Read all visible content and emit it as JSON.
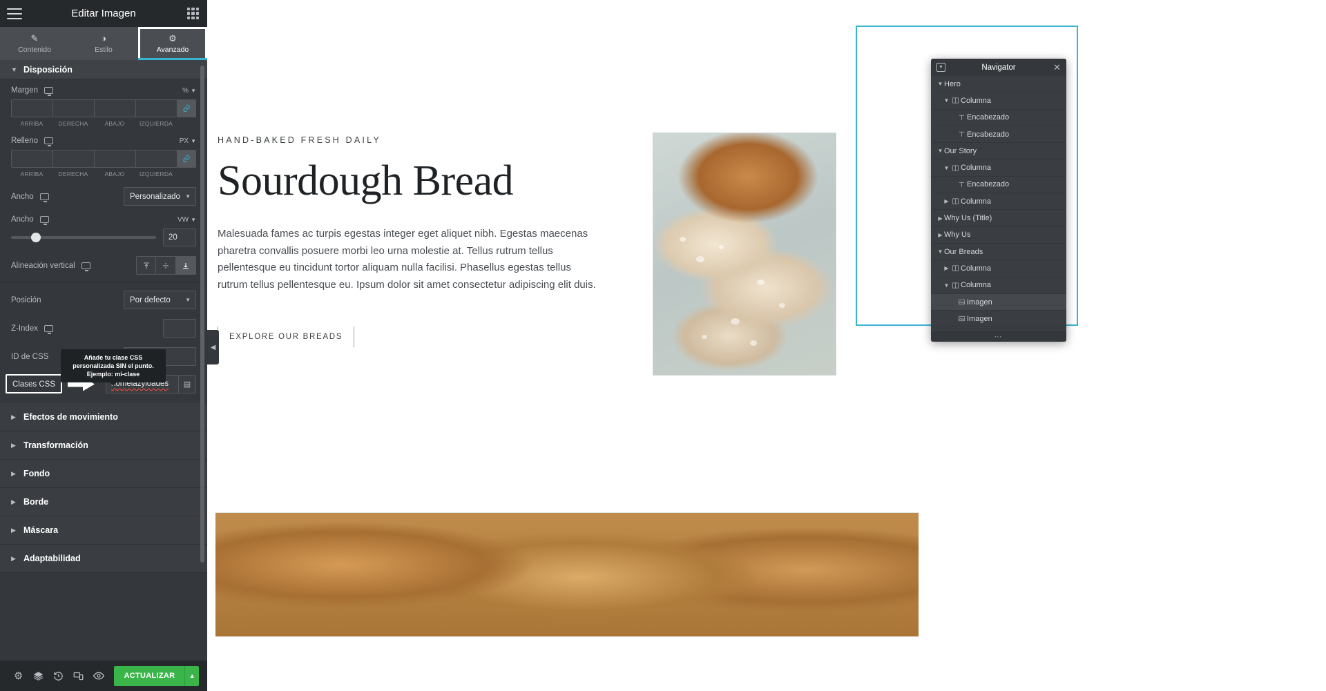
{
  "panel": {
    "title": "Editar Imagen",
    "menu_icon": "hamburger-icon",
    "apps_icon": "apps-grid-icon",
    "tabs": [
      {
        "label": "Contenido",
        "icon": "pencil-icon",
        "active": false
      },
      {
        "label": "Estilo",
        "icon": "contrast-icon",
        "active": false
      },
      {
        "label": "Avanzado",
        "icon": "gear-icon",
        "active": true
      }
    ],
    "sections": {
      "layout": {
        "title": "Disposición",
        "margin": {
          "label": "Margen",
          "unit": "%",
          "values": [
            "",
            "",
            "",
            ""
          ],
          "sides": [
            "ARRIBA",
            "DERECHA",
            "ABAJO",
            "IZQUIERDA"
          ],
          "link_label": "link-icon"
        },
        "padding": {
          "label": "Relleno",
          "unit": "PX",
          "values": [
            "",
            "",
            "",
            ""
          ],
          "sides": [
            "ARRIBA",
            "DERECHA",
            "ABAJO",
            "IZQUIERDA"
          ],
          "link_label": "link-icon"
        },
        "width_mode": {
          "label": "Ancho",
          "value": "Personalizado"
        },
        "width_value": {
          "label": "Ancho",
          "unit": "VW",
          "value": "20",
          "slider_pct": 17
        },
        "vertical_align": {
          "label": "Alineación vertical",
          "options": [
            "top",
            "middle",
            "bottom"
          ],
          "selected": 2
        },
        "position": {
          "label": "Posición",
          "value": "Por defecto"
        },
        "z_index": {
          "label": "Z-Index",
          "value": ""
        },
        "css_id": {
          "label": "ID de CSS",
          "value": ""
        },
        "css_classes": {
          "label": "Clases CSS",
          "value": "nomelazyloades",
          "tooltip": "Añade tu clase CSS personalizada SIN el punto. Ejemplo: mi-clase"
        }
      }
    },
    "collapsed_sections": [
      "Efectos de movimiento",
      "Transformación",
      "Fondo",
      "Borde",
      "Máscara",
      "Adaptabilidad"
    ],
    "footer": {
      "icons": [
        "gear-icon",
        "layers-icon",
        "history-icon",
        "responsive-icon",
        "eye-icon"
      ],
      "update_label": "ACTUALIZAR",
      "update_caret": "caret-up-icon"
    }
  },
  "canvas": {
    "eyebrow": "HAND-BAKED FRESH DAILY",
    "title": "Sourdough Bread",
    "body": "Malesuada fames ac turpis egestas integer eget aliquet nibh. Egestas maecenas pharetra convallis posuere morbi leo urna molestie at. Tellus rutrum tellus pellentesque eu tincidunt tortor aliquam nulla facilisi. Phasellus egestas tellus rutrum tellus pellentesque eu. Ipsum dolor sit amet consectetur adipiscing elit duis.",
    "cta": "EXPLORE OUR BREADS"
  },
  "navigator": {
    "title": "Navigator",
    "dock_icon": "dock-icon",
    "close_icon": "close-icon",
    "more_icon": "ellipsis-icon",
    "items": [
      {
        "label": "Hero",
        "indent": 0,
        "caret": "down",
        "icon": ""
      },
      {
        "label": "Columna",
        "indent": 1,
        "caret": "down",
        "icon": "column-icon"
      },
      {
        "label": "Encabezado",
        "indent": 2,
        "caret": "none",
        "icon": "heading-icon"
      },
      {
        "label": "Encabezado",
        "indent": 2,
        "caret": "none",
        "icon": "heading-icon"
      },
      {
        "label": "Our Story",
        "indent": 0,
        "caret": "down",
        "icon": ""
      },
      {
        "label": "Columna",
        "indent": 1,
        "caret": "down",
        "icon": "column-icon"
      },
      {
        "label": "Encabezado",
        "indent": 2,
        "caret": "none",
        "icon": "heading-icon"
      },
      {
        "label": "Columna",
        "indent": 1,
        "caret": "right",
        "icon": "column-icon"
      },
      {
        "label": "Why Us (Title)",
        "indent": 0,
        "caret": "right",
        "icon": ""
      },
      {
        "label": "Why Us",
        "indent": 0,
        "caret": "right",
        "icon": ""
      },
      {
        "label": "Our Breads",
        "indent": 0,
        "caret": "down",
        "icon": ""
      },
      {
        "label": "Columna",
        "indent": 1,
        "caret": "right",
        "icon": "column-icon"
      },
      {
        "label": "Columna",
        "indent": 1,
        "caret": "down",
        "icon": "column-icon"
      },
      {
        "label": "Imagen",
        "indent": 2,
        "caret": "none",
        "icon": "image-icon",
        "selected": true
      },
      {
        "label": "Imagen",
        "indent": 2,
        "caret": "none",
        "icon": "image-icon"
      }
    ]
  },
  "colors": {
    "accent": "#39b5d4",
    "update_green": "#39b54a",
    "panel_bg": "#34383c",
    "error_underline": "#e04a3f"
  }
}
